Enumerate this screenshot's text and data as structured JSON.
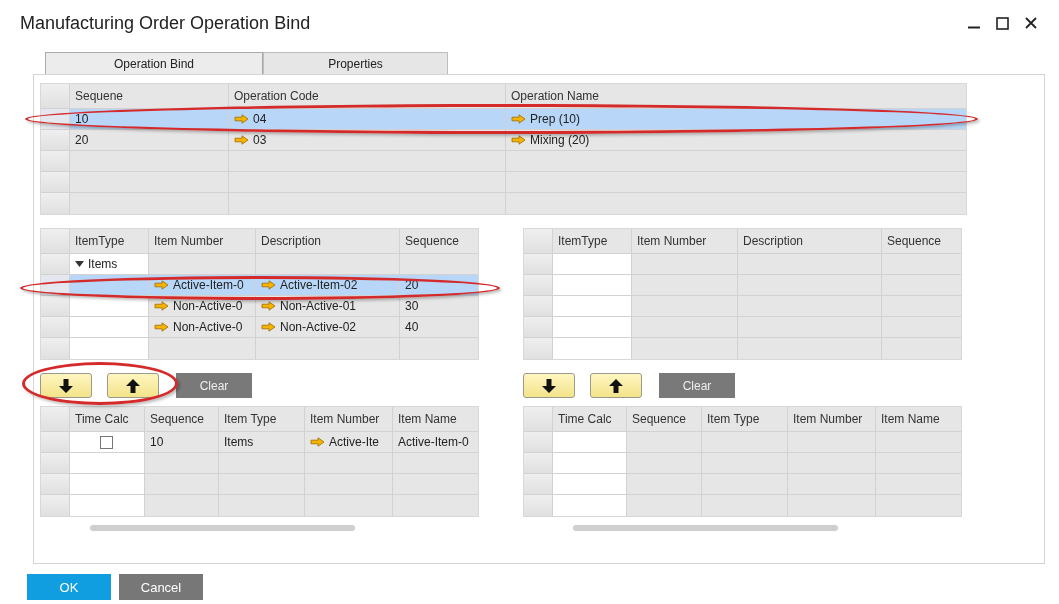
{
  "window": {
    "title": "Manufacturing Order Operation Bind"
  },
  "tabs": [
    {
      "label": "Operation Bind",
      "selected": true
    },
    {
      "label": "Properties",
      "selected": false
    }
  ],
  "operations": {
    "columns": [
      "Sequene",
      "Operation Code",
      "Operation Name"
    ],
    "rows": [
      {
        "sequence": "10",
        "code": "04",
        "name": "Prep (10)",
        "selected": true
      },
      {
        "sequence": "20",
        "code": "03",
        "name": "Mixing (20)",
        "selected": false
      }
    ]
  },
  "items_left": {
    "columns": [
      "ItemType",
      "Item Number",
      "Description",
      "Sequence"
    ],
    "group": {
      "label": "Items",
      "expanded": true
    },
    "rows": [
      {
        "item_number": "Active-Item-0",
        "description": "Active-Item-02",
        "sequence": "20",
        "selected": true
      },
      {
        "item_number": "Non-Active-0",
        "description": "Non-Active-01",
        "sequence": "30",
        "selected": false
      },
      {
        "item_number": "Non-Active-0",
        "description": "Non-Active-02",
        "sequence": "40",
        "selected": false
      }
    ]
  },
  "items_right": {
    "columns": [
      "ItemType",
      "Item Number",
      "Description",
      "Sequence"
    ]
  },
  "clear_buttons": [
    "Clear",
    "Clear"
  ],
  "binds_left": {
    "columns": [
      "Time Calc",
      "Sequence",
      "Item Type",
      "Item Number",
      "Item Name"
    ],
    "rows": [
      {
        "time_calc": false,
        "sequence": "10",
        "item_type": "Items",
        "item_number": "Active-Ite",
        "item_name": "Active-Item-0"
      }
    ]
  },
  "binds_right": {
    "columns": [
      "Time Calc",
      "Sequence",
      "Item Type",
      "Item Number",
      "Item Name"
    ]
  },
  "footer_buttons": [
    {
      "label": "OK",
      "kind": "primary"
    },
    {
      "label": "Cancel",
      "kind": "secondary"
    }
  ]
}
